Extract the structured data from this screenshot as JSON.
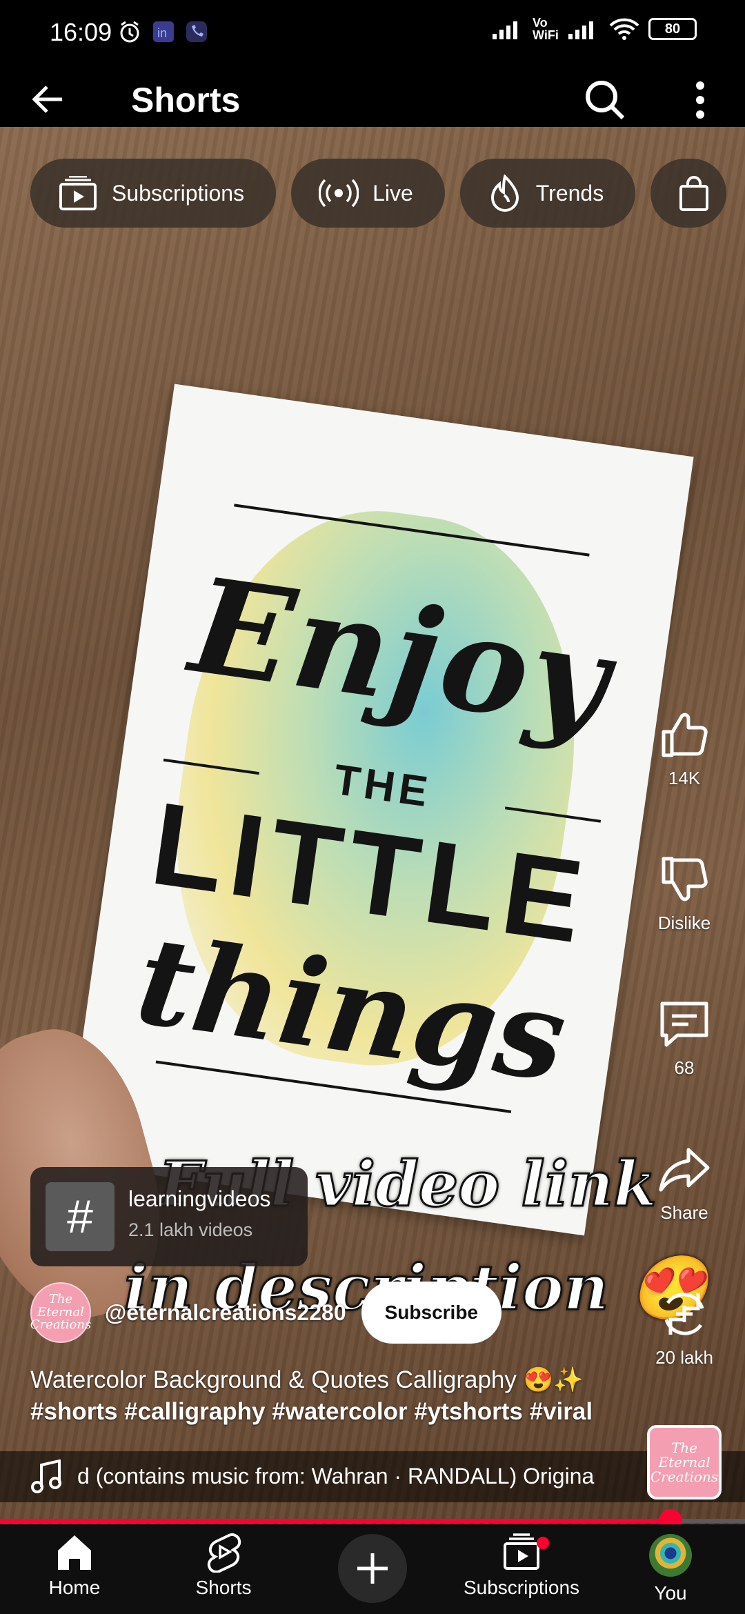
{
  "status_bar": {
    "time": "16:09",
    "network": "Vo WiFi",
    "battery": "80"
  },
  "top_bar": {
    "title": "Shorts"
  },
  "chips": [
    {
      "label": "Subscriptions",
      "icon": "subscriptions-icon"
    },
    {
      "label": "Live",
      "icon": "live-icon"
    },
    {
      "label": "Trends",
      "icon": "trends-icon"
    },
    {
      "label": "",
      "icon": "shopping-bag-icon"
    }
  ],
  "video": {
    "quote_lines": [
      "Enjoy",
      "THE",
      "LITTLE",
      "things"
    ],
    "overlay_line1": "Full video link",
    "overlay_line2": "in description 😍"
  },
  "actions": {
    "like_count": "14K",
    "dislike_label": "Dislike",
    "comment_count": "68",
    "share_label": "Share",
    "remix_count": "20 lakh"
  },
  "hashtag_card": {
    "title": "learningvideos",
    "subtitle": "2.1 lakh videos"
  },
  "channel": {
    "avatar_text": "The Eternal Creations",
    "handle": "@eternalcreations2280",
    "subscribe_label": "Subscribe"
  },
  "caption": {
    "title": "Watercolor Background & Quotes Calligraphy 😍✨",
    "tags": "#shorts #calligraphy #watercolor #ytshorts #viral"
  },
  "music": {
    "text": "d (contains music from: Wahran · RANDALL)    Origina"
  },
  "playback": {
    "progress": 0.9
  },
  "bottom_nav": {
    "home": "Home",
    "shorts": "Shorts",
    "subscriptions": "Subscriptions",
    "you": "You"
  },
  "colors": {
    "accent": "#ff0033",
    "chip_bg": "#3c322a",
    "nav_bg": "#0f0f0f"
  }
}
